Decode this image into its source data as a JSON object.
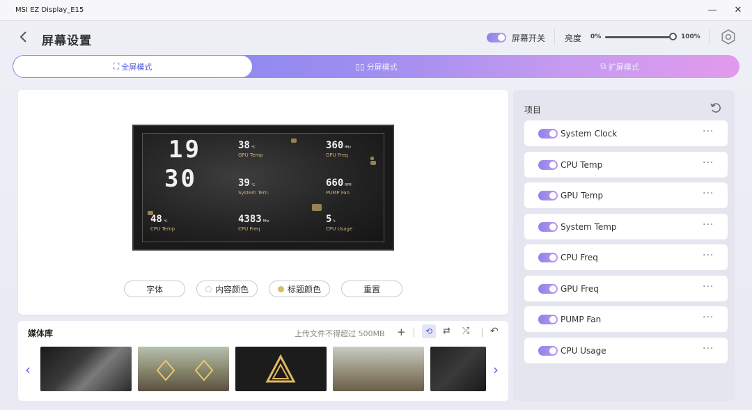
{
  "window": {
    "title": "MSI EZ Display_E15",
    "minimize": "—",
    "close": "✕"
  },
  "header": {
    "page_title": "屏幕设置",
    "screen_switch_label": "屏幕开关",
    "brightness_label": "亮度",
    "brightness_min": "0%",
    "brightness_max": "100%",
    "brightness_value": 1.0
  },
  "tabs": [
    {
      "label": "全屏模式",
      "icon": "⛶"
    },
    {
      "label": "分屏模式",
      "icon": "▯▯"
    },
    {
      "label": "扩屏模式",
      "icon": "⧉"
    }
  ],
  "preview": {
    "clock_hour": "19",
    "clock_minute": "30",
    "metrics": {
      "cpu_temp": {
        "value": "48",
        "unit": "℃",
        "label": "CPU Temp"
      },
      "gpu_temp": {
        "value": "38",
        "unit": "℃",
        "label": "GPU Temp"
      },
      "system_temp": {
        "value": "39",
        "unit": "℃",
        "label": "System Tem."
      },
      "cpu_freq": {
        "value": "4383",
        "unit": "MHz",
        "label": "CPU Freq"
      },
      "gpu_freq": {
        "value": "360",
        "unit": "MHz",
        "label": "GPU Freq"
      },
      "pump_fan": {
        "value": "660",
        "unit": "RPM",
        "label": "PUMP Fan"
      },
      "cpu_usage": {
        "value": "5",
        "unit": "%",
        "label": "CPU Usage"
      }
    },
    "buttons": {
      "font": "字体",
      "content_color": "内容颜色",
      "title_color": "标题颜色",
      "reset": "重置"
    },
    "title_color_dot": "#d9b96a"
  },
  "media": {
    "title": "媒体库",
    "upload_hint": "上传文件不得超过 500MB",
    "add_icon": "+",
    "prev": "‹",
    "next": "›"
  },
  "items_panel": {
    "title": "项目",
    "items": [
      {
        "label": "System Clock"
      },
      {
        "label": "CPU Temp"
      },
      {
        "label": "GPU Temp"
      },
      {
        "label": "System Temp"
      },
      {
        "label": "CPU Freq"
      },
      {
        "label": "GPU Freq"
      },
      {
        "label": "PUMP Fan"
      },
      {
        "label": "CPU Usage"
      }
    ],
    "more": "···"
  },
  "colors": {
    "accent": "#8f83ea",
    "tab_active_text": "#4b5ad8"
  }
}
